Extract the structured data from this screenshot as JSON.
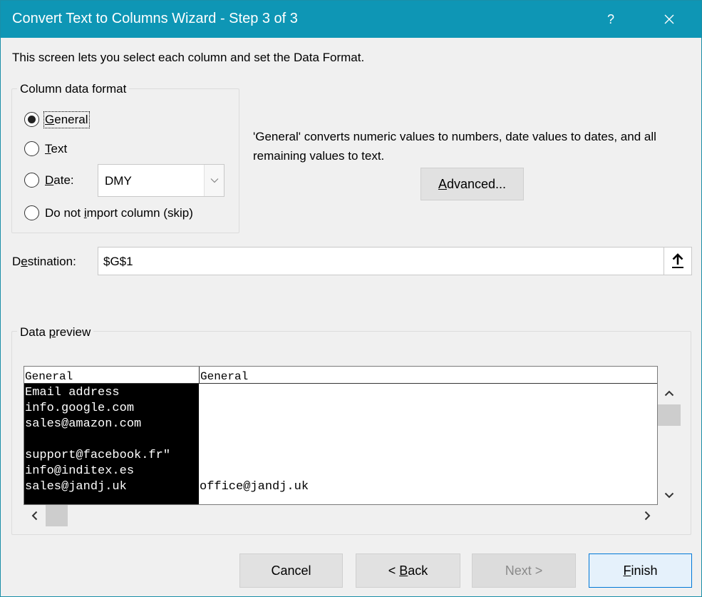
{
  "window": {
    "title": "Convert Text to Columns Wizard - Step 3 of 3",
    "help_label": "?"
  },
  "intro_text": "This screen lets you select each column and set the Data Format.",
  "column_format": {
    "group_label": "Column data format",
    "options": [
      {
        "key": "G",
        "rest": "eneral",
        "selected": true
      },
      {
        "key": "T",
        "rest": "ext",
        "selected": false
      },
      {
        "key": "D",
        "rest": "ate:",
        "selected": false
      },
      {
        "pre": "Do not ",
        "key": "i",
        "rest": "mport column (skip)",
        "selected": false
      }
    ],
    "date_select_value": "DMY"
  },
  "description_text": "'General' converts numeric values to numbers, date values to dates, and all remaining values to text.",
  "advanced_button": {
    "key": "A",
    "rest": "dvanced..."
  },
  "destination": {
    "label_pre": "D",
    "label_key": "e",
    "label_rest": "stination:",
    "value": "$G$1"
  },
  "data_preview": {
    "group_label_pre": "Data ",
    "group_label_key": "p",
    "group_label_rest": "review",
    "headers": [
      "General",
      "General"
    ],
    "column1": [
      "Email address",
      "info.google.com",
      "sales@amazon.com",
      "",
      "support@facebook.fr\"",
      "info@inditex.es",
      "sales@jandj.uk"
    ],
    "column2": [
      "",
      "",
      "",
      "",
      "",
      "",
      "office@jandj.uk"
    ]
  },
  "footer": {
    "cancel": "Cancel",
    "back_pre": "< ",
    "back_key": "B",
    "back_rest": "ack",
    "next": "Next >",
    "finish_key": "F",
    "finish_rest": "inish"
  },
  "colors": {
    "titlebar": "#0e96b5",
    "selected_column": "#000000",
    "default_button_border": "#0078d7"
  },
  "icons": {
    "help": "question-mark",
    "close": "x-mark",
    "collapse": "up-arrow",
    "dropdown": "chevron-down",
    "scroll_up": "chevron-up",
    "scroll_down": "chevron-down",
    "scroll_left": "chevron-left",
    "scroll_right": "chevron-right"
  }
}
